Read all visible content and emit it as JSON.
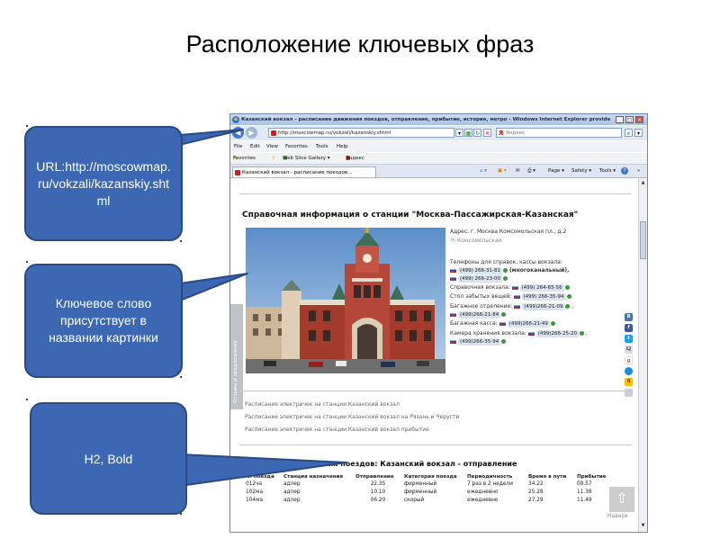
{
  "slide": {
    "title": "Расположение ключевых фраз"
  },
  "callouts": [
    {
      "text": "URL:http://moscowmap.ru/vokzali/kazanskiy.shtml"
    },
    {
      "text": "Ключевое слово присутствует в названии картинки"
    },
    {
      "text": "H2, Bold"
    }
  ],
  "browser": {
    "window_title": "Казанский вокзал - расписание движения поездов, отправление, прибытие, история, метро - Windows Internet Explorer provided ...",
    "address": "http://moscowmap.ru/vokzali/kazanskiy.shtml",
    "search_placeholder": "Яндекс",
    "menu": [
      "File",
      "Edit",
      "View",
      "Favorites",
      "Tools",
      "Help"
    ],
    "favorites_bar": {
      "favorites_label": "Favorites",
      "web_slice_label": "Web Slice Gallery ▾",
      "yandex_label": "Яндекс"
    },
    "tab_label": "Казанский вокзал - расписание поездов...",
    "tab_tools": {
      "page": "Page ▾",
      "safety": "Safety ▾",
      "tools": "Tools ▾",
      "help": "?"
    },
    "colors": {
      "ie_blue": "#3f78c8",
      "callout_fill": "#3b67b3"
    }
  },
  "page": {
    "heading": "Справочная информация о станции \"Москва-Пассажирская-Казанская\"",
    "photo_side_label": "Отзывы и предложения",
    "address": "Адрес: г. Москва Комсомольская пл., д.2",
    "metro": "Комсомольская",
    "phones_label": "Телефоны для справок, кассы вокзала:",
    "phone_1": "(499) 266-31-81",
    "phone_1_note": "(многоканальный),",
    "phone_2": "(499) 266-23-00",
    "help_label": "Справочная вокзала:",
    "help_phone": "(499) 264-65-56",
    "lost_label": "Стол забытых вещей:",
    "lost_phone": "(499) 266-35-94",
    "baggage_label": "Багажное отделение:",
    "baggage_phone_1": "(499)266-21-09",
    "baggage_phone_2": "(499)266-21-84",
    "baggage_office_label": "Багажная касса:",
    "baggage_office_phone": "(499)266-21-49",
    "storage_label": "Камера хранения вокзала:",
    "storage_phone_1": "(499)266-25-20",
    "storage_phone_2": "(499)266-35-94",
    "links": [
      "Расписание электричек на станции Казанский вокзал",
      "Расписание электричек на станции Казанский вокзал на Рязань и Черусти",
      "Расписание электричек на станции Казанский вокзал прибытие"
    ],
    "schedule_heading": "Расписание движения поездов: Казанский вокзал - отправление",
    "schedule_columns": [
      "№ поезда",
      "Станция назначения",
      "Отправление",
      "Категория поезда",
      "Периодичность",
      "Время в пути",
      "Прибытие"
    ],
    "schedule_rows": [
      [
        "012ча",
        "адлер",
        "22.35",
        "фирменный",
        "7 раз в 2 недели",
        "34.22",
        "08.57"
      ],
      [
        "102ма",
        "адлер",
        "10.10",
        "фирменный",
        "ежедневно",
        "25.28",
        "11.38"
      ],
      [
        "104ма",
        "адлер",
        "06.20",
        "скорый",
        "ежедневно",
        "27.29",
        "11.49"
      ]
    ],
    "up_label": "Наверх",
    "socials": [
      "В",
      "f",
      "t",
      "LJ",
      "g",
      "",
      "Я",
      ""
    ]
  }
}
